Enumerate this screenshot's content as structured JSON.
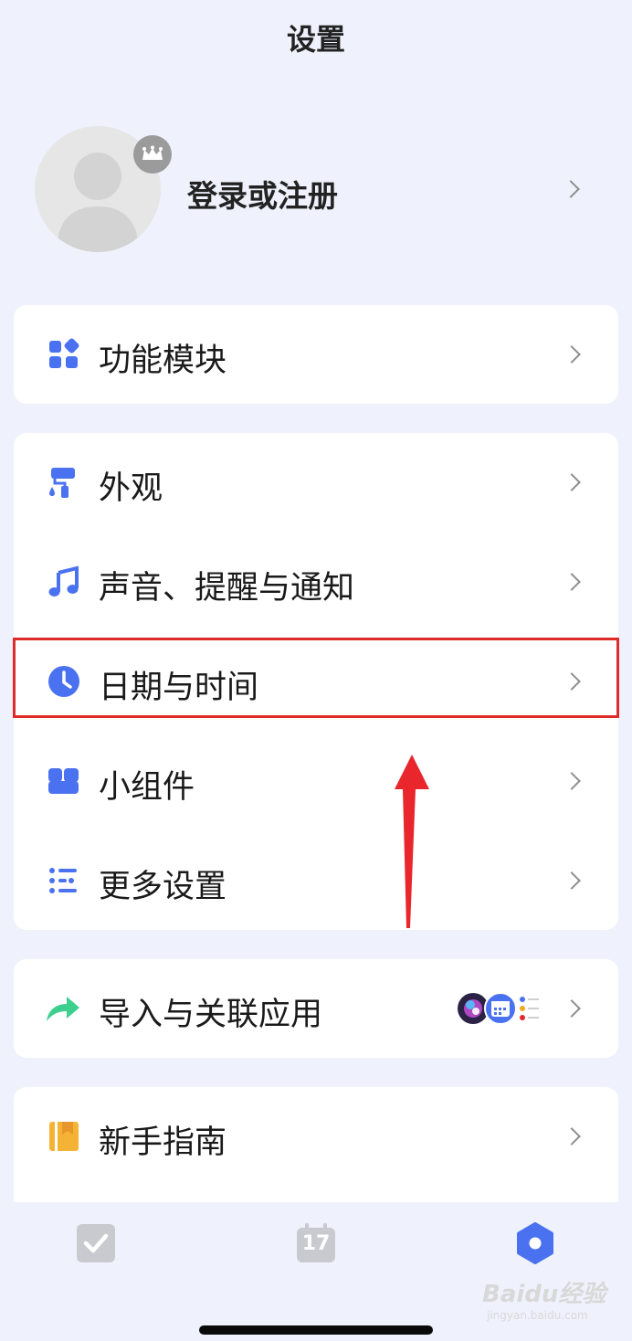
{
  "header": {
    "title": "设置"
  },
  "profile": {
    "login_label": "登录或注册"
  },
  "groups": {
    "modules": {
      "label": "功能模块"
    },
    "appearance": {
      "label": "外观"
    },
    "sound": {
      "label": "声音、提醒与通知"
    },
    "datetime": {
      "label": "日期与时间"
    },
    "widgets": {
      "label": "小组件"
    },
    "more": {
      "label": "更多设置"
    },
    "import": {
      "label": "导入与关联应用"
    },
    "guide": {
      "label": "新手指南"
    }
  },
  "tabbar": {
    "calendar_day": "17",
    "items": [
      "task-tab",
      "calendar-tab",
      "settings-tab"
    ]
  },
  "watermark": {
    "brand": "Baidu经验",
    "url": "jingyan.baidu.com"
  },
  "colors": {
    "accent": "#4a72f0",
    "highlight": "#e02b2b",
    "arrow": "#e8262b",
    "share": "#3dcf8e",
    "guide": "#f5b335",
    "background": "#eff2fc"
  }
}
